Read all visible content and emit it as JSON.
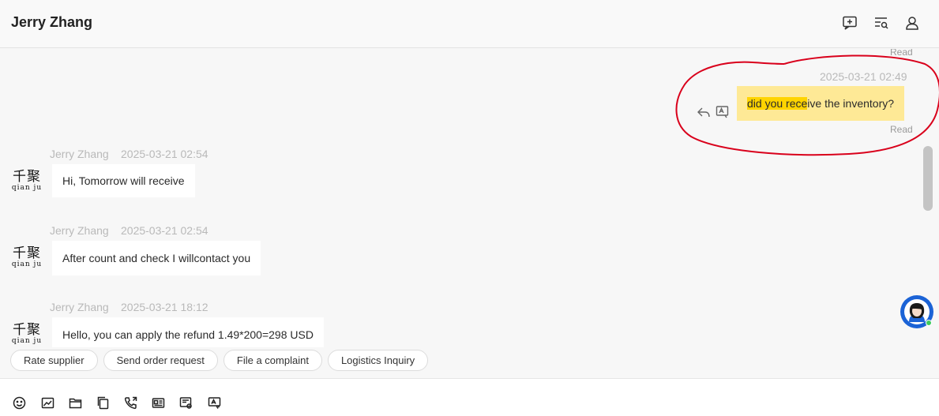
{
  "header": {
    "title": "Jerry Zhang",
    "icons": [
      "new-message-icon",
      "search-list-icon",
      "user-profile-icon"
    ]
  },
  "messages": [
    {
      "direction": "outgoing",
      "timestamp": "2025-03-21 02:49",
      "text_highlight": "did you rece",
      "text_rest": "ive the inventory?",
      "status": "Read"
    },
    {
      "direction": "incoming",
      "sender": "Jerry Zhang",
      "timestamp": "2025-03-21 02:54",
      "text": "Hi, Tomorrow will receive"
    },
    {
      "direction": "incoming",
      "sender": "Jerry Zhang",
      "timestamp": "2025-03-21 02:54",
      "text": "After count and check I willcontact you"
    },
    {
      "direction": "incoming",
      "sender": "Jerry Zhang",
      "timestamp": "2025-03-21 18:12",
      "text": "Hello, you can apply the refund 1.49*200=298 USD"
    }
  ],
  "previous_status": "Read",
  "avatar": {
    "zh": "千聚",
    "pinyin": "qian ju"
  },
  "quick_actions": [
    "Rate supplier",
    "Send order request",
    "File a complaint",
    "Logistics Inquiry"
  ],
  "toolbar": {
    "icons": [
      "emoji-icon",
      "image-icon",
      "folder-icon",
      "copy-icon",
      "phone-call-icon",
      "id-card-icon",
      "document-list-icon",
      "screen-capture-icon"
    ]
  },
  "colors": {
    "outgoing_bubble": "#fee996",
    "highlight": "#ffd400",
    "annotation": "#d9001b",
    "support_button": "#1b63d6"
  }
}
